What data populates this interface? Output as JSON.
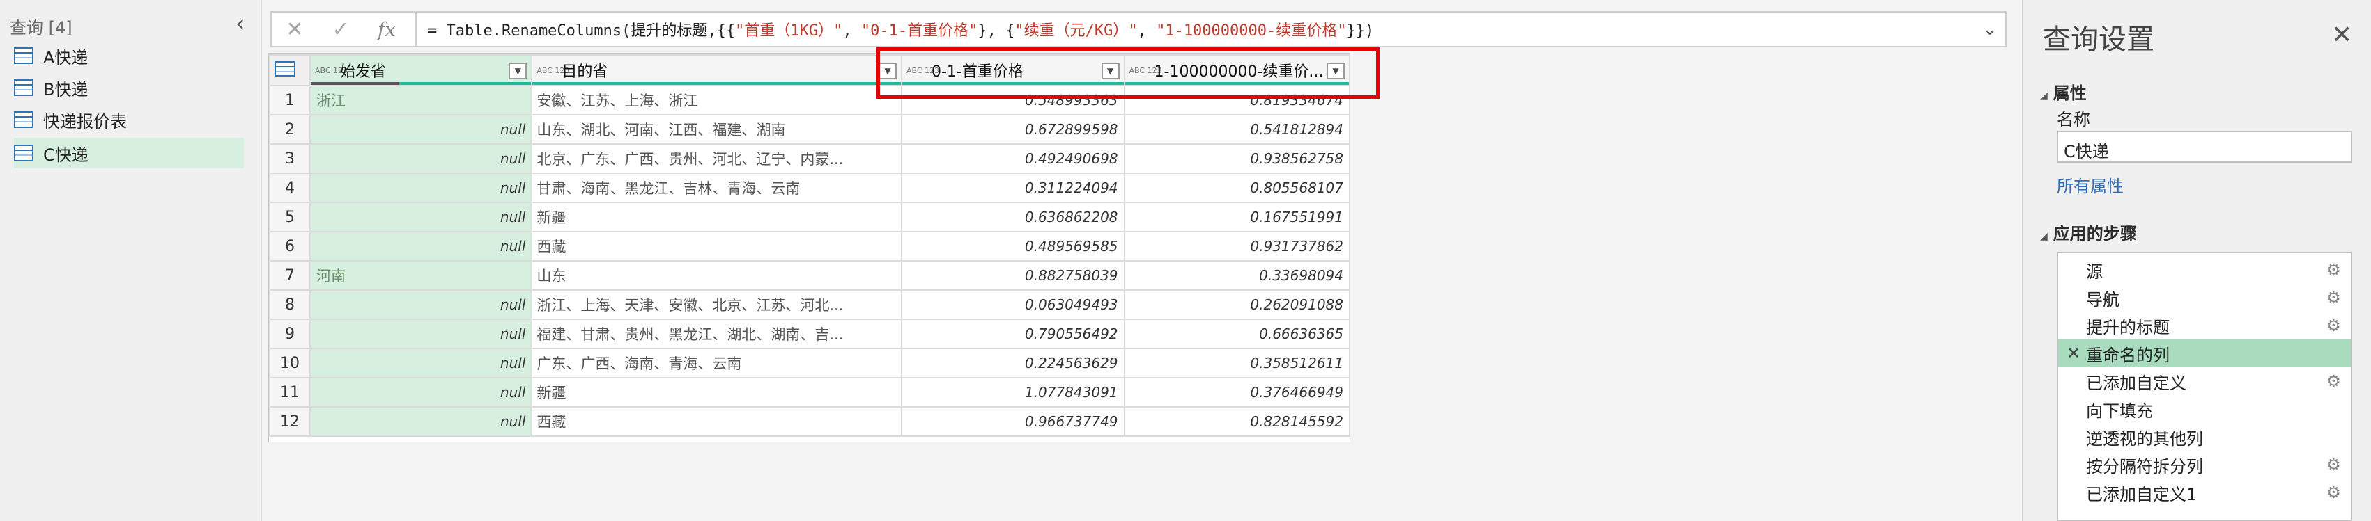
{
  "left_pane": {
    "header": "查询 [4]",
    "collapse_icon": "‹",
    "queries": [
      {
        "label": "A快递",
        "selected": false
      },
      {
        "label": "B快递",
        "selected": false
      },
      {
        "label": "快递报价表",
        "selected": false
      },
      {
        "label": "C快递",
        "selected": true
      }
    ]
  },
  "formula_bar": {
    "cancel_icon": "✕",
    "confirm_icon": "✓",
    "fx_label": "fx",
    "formula_prefix": "= Table.RenameColumns(提升的标题,{{",
    "s1": "\"首重（1KG）\"",
    "sep1": ", ",
    "s2": "\"0-1-首重价格\"",
    "sep2": "}, {",
    "s3": "\"续重（元/KG）\"",
    "sep3": ", ",
    "s4": "\"1-100000000-续重价格\"",
    "formula_suffix": "}})",
    "expand_icon": "⌄"
  },
  "grid": {
    "type_badge": "ABC 123",
    "columns": [
      "始发省",
      "目的省",
      "0-1-首重价格",
      "1-100000000-续重价..."
    ],
    "rows": [
      {
        "n": "1",
        "origin": "浙江",
        "dest": "安徽、江苏、上海、浙江",
        "first": "0.548993363",
        "cont": "0.819334674"
      },
      {
        "n": "2",
        "origin": "null",
        "dest": "山东、湖北、河南、江西、福建、湖南",
        "first": "0.672899598",
        "cont": "0.541812894"
      },
      {
        "n": "3",
        "origin": "null",
        "dest": "北京、广东、广西、贵州、河北、辽宁、内蒙...",
        "first": "0.492490698",
        "cont": "0.938562758"
      },
      {
        "n": "4",
        "origin": "null",
        "dest": "甘肃、海南、黑龙江、吉林、青海、云南",
        "first": "0.311224094",
        "cont": "0.805568107"
      },
      {
        "n": "5",
        "origin": "null",
        "dest": "新疆",
        "first": "0.636862208",
        "cont": "0.167551991"
      },
      {
        "n": "6",
        "origin": "null",
        "dest": "西藏",
        "first": "0.489569585",
        "cont": "0.931737862"
      },
      {
        "n": "7",
        "origin": "河南",
        "dest": "山东",
        "first": "0.882758039",
        "cont": "0.33698094"
      },
      {
        "n": "8",
        "origin": "null",
        "dest": "浙江、上海、天津、安徽、北京、江苏、河北...",
        "first": "0.063049493",
        "cont": "0.262091088"
      },
      {
        "n": "9",
        "origin": "null",
        "dest": "福建、甘肃、贵州、黑龙江、湖北、湖南、吉...",
        "first": "0.790556492",
        "cont": "0.66636365"
      },
      {
        "n": "10",
        "origin": "null",
        "dest": "广东、广西、海南、青海、云南",
        "first": "0.224563629",
        "cont": "0.358512611"
      },
      {
        "n": "11",
        "origin": "null",
        "dest": "新疆",
        "first": "1.077843091",
        "cont": "0.376466949"
      },
      {
        "n": "12",
        "origin": "null",
        "dest": "西藏",
        "first": "0.966737749",
        "cont": "0.828145592"
      }
    ]
  },
  "right_pane": {
    "title": "查询设置",
    "close_icon": "✕",
    "properties_header": "属性",
    "name_label": "名称",
    "name_value": "C快递",
    "all_properties_link": "所有属性",
    "steps_header": "应用的步骤",
    "steps": [
      {
        "label": "源",
        "gear": true,
        "selected": false
      },
      {
        "label": "导航",
        "gear": true,
        "selected": false
      },
      {
        "label": "提升的标题",
        "gear": true,
        "selected": false
      },
      {
        "label": "重命名的列",
        "gear": false,
        "selected": true
      },
      {
        "label": "已添加自定义",
        "gear": true,
        "selected": false
      },
      {
        "label": "向下填充",
        "gear": false,
        "selected": false
      },
      {
        "label": "逆透视的其他列",
        "gear": false,
        "selected": false
      },
      {
        "label": "按分隔符拆分列",
        "gear": true,
        "selected": false
      },
      {
        "label": "已添加自定义1",
        "gear": true,
        "selected": false
      }
    ]
  },
  "colors": {
    "selected_green": "#d6efdf",
    "highlight_red": "#e60000",
    "link_blue": "#2e6fb7",
    "accent_teal": "#1abc9c"
  }
}
